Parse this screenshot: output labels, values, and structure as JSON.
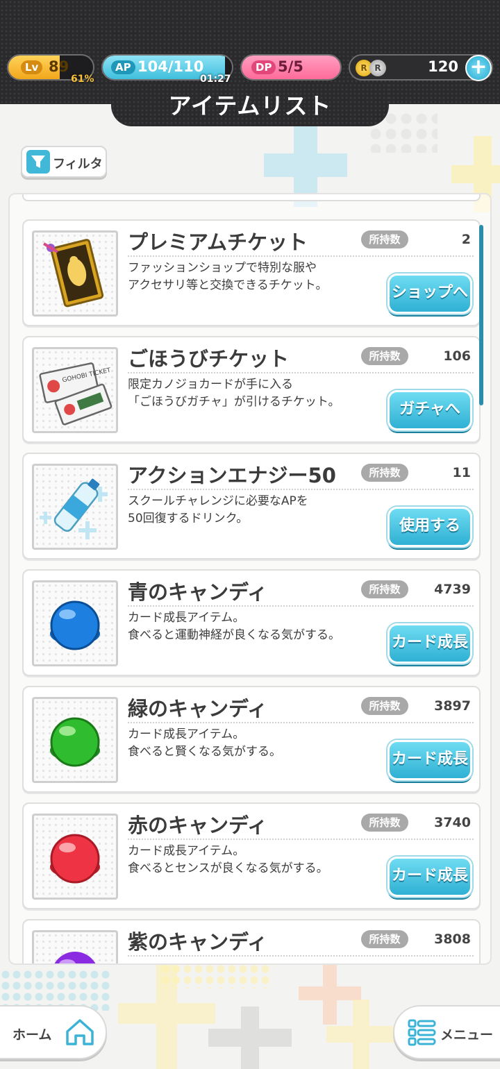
{
  "status": {
    "lv_label": "Lv",
    "lv_value": "89",
    "lv_percent": "61%",
    "lv_progress": 0.61,
    "ap_label": "AP",
    "ap_value": "104/110",
    "ap_timer": "01:27",
    "ap_progress": 0.945,
    "dp_label": "DP",
    "dp_value": "5/5",
    "coin_gold_glyph": "R",
    "coin_silver_glyph": "R",
    "coins": "120",
    "add_glyph": "+"
  },
  "page": {
    "title": "アイテムリスト"
  },
  "filter": {
    "label": "フィルタ"
  },
  "own_label": "所持数",
  "items": [
    {
      "name": "プレミアムチケット",
      "count": "2",
      "desc": "ファッションショップで特別な服や\nアクセサリ等と交換できるチケット。",
      "action": "ショップへ",
      "icon": "premium-ticket-icon"
    },
    {
      "name": "ごほうびチケット",
      "count": "106",
      "desc": "限定カノジョカードが手に入る\n「ごほうびガチャ」が引けるチケット。",
      "action": "ガチャへ",
      "icon": "reward-ticket-icon",
      "icon_text": "GOHOBI TICKET"
    },
    {
      "name": "アクションエナジー50",
      "count": "11",
      "desc": "スクールチャレンジに必要なAPを\n50回復するドリンク。",
      "action": "使用する",
      "icon": "energy-drink-icon"
    },
    {
      "name": "青のキャンディ",
      "count": "4739",
      "desc": "カード成長アイテム。\n食べると運動神経が良くなる気がする。",
      "action": "カード成長",
      "icon": "blue-candy-icon"
    },
    {
      "name": "緑のキャンディ",
      "count": "3897",
      "desc": "カード成長アイテム。\n食べると賢くなる気がする。",
      "action": "カード成長",
      "icon": "green-candy-icon"
    },
    {
      "name": "赤のキャンディ",
      "count": "3740",
      "desc": "カード成長アイテム。\n食べるとセンスが良くなる気がする。",
      "action": "カード成長",
      "icon": "red-candy-icon"
    },
    {
      "name": "紫のキャンディ",
      "count": "3808",
      "desc": "",
      "action": "",
      "icon": "purple-candy-icon"
    }
  ],
  "nav": {
    "home": "ホーム",
    "menu": "メニュー"
  },
  "colors": {
    "accent": "#2fb0d3",
    "header_bg": "#2a2a2c",
    "badge": "#a9a9a9"
  }
}
